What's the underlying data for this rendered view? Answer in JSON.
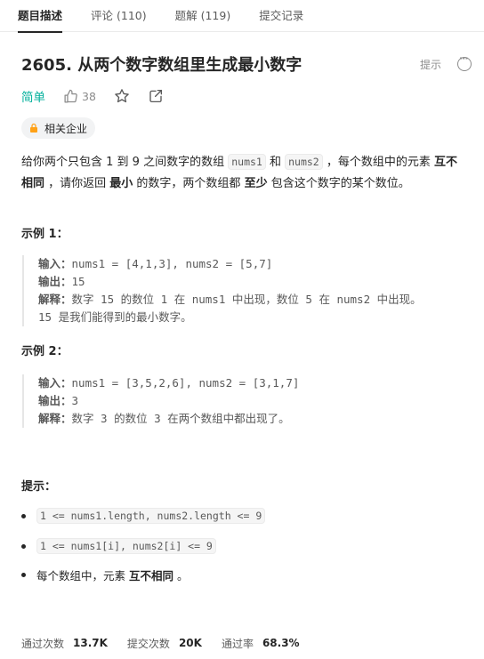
{
  "tabs": [
    {
      "label": "题目描述"
    },
    {
      "label": "评论 (110)"
    },
    {
      "label": "题解 (119)"
    },
    {
      "label": "提交记录"
    }
  ],
  "problem": {
    "title": "2605. 从两个数字数组里生成最小数字",
    "hint_label": "提示",
    "difficulty": "简单",
    "likes": "38",
    "tag_label": "相关企业",
    "accent_color": "#00af9b",
    "icons": [
      "thumbs-up-icon",
      "star-icon",
      "share-icon",
      "lock-icon",
      "more-icon"
    ]
  },
  "description": {
    "p1": "给你两个只包含 1 到 9 之间数字的数组 ",
    "c1": "nums1",
    "p2": " 和 ",
    "c2": "nums2",
    "p3": " ，每个数组中的元素 ",
    "b1": "互不相同",
    "p4": " ，请你返回 ",
    "b2": "最小",
    "p5": " 的数字，两个数组都 ",
    "b3": "至少",
    "p6": " 包含这个数字的某个数位。"
  },
  "examples": [
    {
      "title": "示例 1：",
      "input_label": "输入：",
      "input": "nums1 = [4,1,3], nums2 = [5,7]",
      "output_label": "输出：",
      "output": "15",
      "explain_label": "解释：",
      "explain_line1": "数字 15 的数位 1 在 nums1 中出现，数位 5 在 nums2 中出现。",
      "explain_line2": "15 是我们能得到的最小数字。"
    },
    {
      "title": "示例 2：",
      "input_label": "输入：",
      "input": "nums1 = [3,5,2,6], nums2 = [3,1,7]",
      "output_label": "输出：",
      "output": "3",
      "explain_label": "解释：",
      "explain_line1": "数字 3 的数位 3 在两个数组中都出现了。"
    }
  ],
  "tips": {
    "title": "提示：",
    "items": [
      "1 <= nums1.length, nums2.length <= 9",
      "1 <= nums1[i], nums2[i] <= 9"
    ],
    "last_prefix": "每个数组中，元素 ",
    "last_bold": "互不相同",
    "last_suffix": " 。"
  },
  "stats": {
    "accepted_label": "通过次数",
    "accepted": "13.7K",
    "submissions_label": "提交次数",
    "submissions": "20K",
    "rate_label": "通过率",
    "rate": "68.3%"
  }
}
